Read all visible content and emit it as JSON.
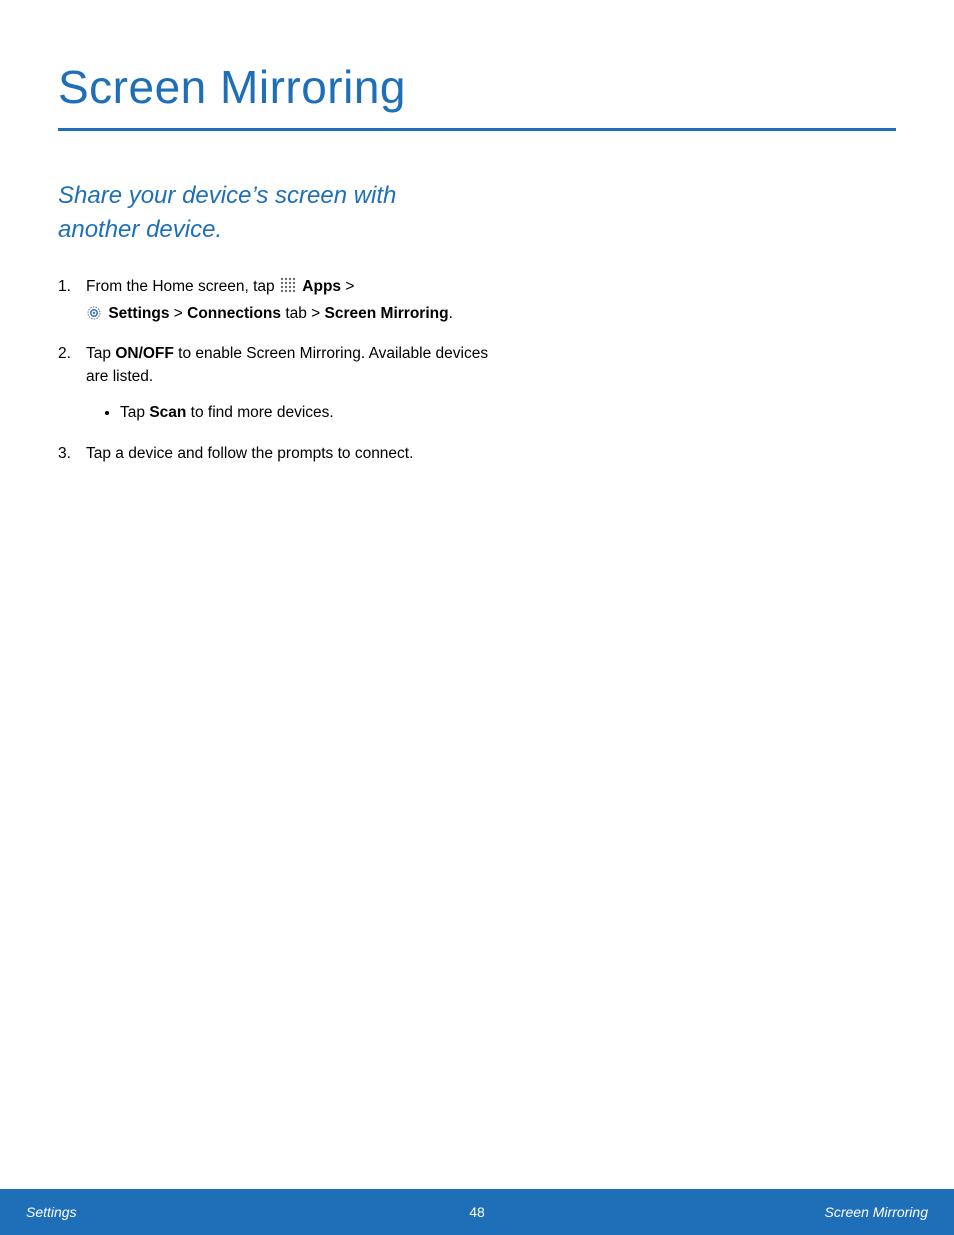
{
  "title": "Screen Mirroring",
  "subtitle": "Share your device’s screen with another device.",
  "steps": {
    "one": {
      "pre_icon": "From the Home screen, tap ",
      "apps": "Apps",
      "after_apps": " > ",
      "settings": "Settings",
      "after_settings": " > ",
      "connections": "Connections",
      "after_connections": " tab > ",
      "screen_mirroring": "Screen Mirroring",
      "end": "."
    },
    "two": {
      "pre": "Tap ",
      "onoff": "ON/OFF",
      "post": " to enable Screen Mirroring. Available devices are listed.",
      "bullet": {
        "pre": "Tap ",
        "scan": "Scan",
        "post": " to find more devices."
      }
    },
    "three": "Tap a device and follow the prompts to connect."
  },
  "footer": {
    "left": "Settings",
    "page": "48",
    "right": "Screen Mirroring"
  }
}
